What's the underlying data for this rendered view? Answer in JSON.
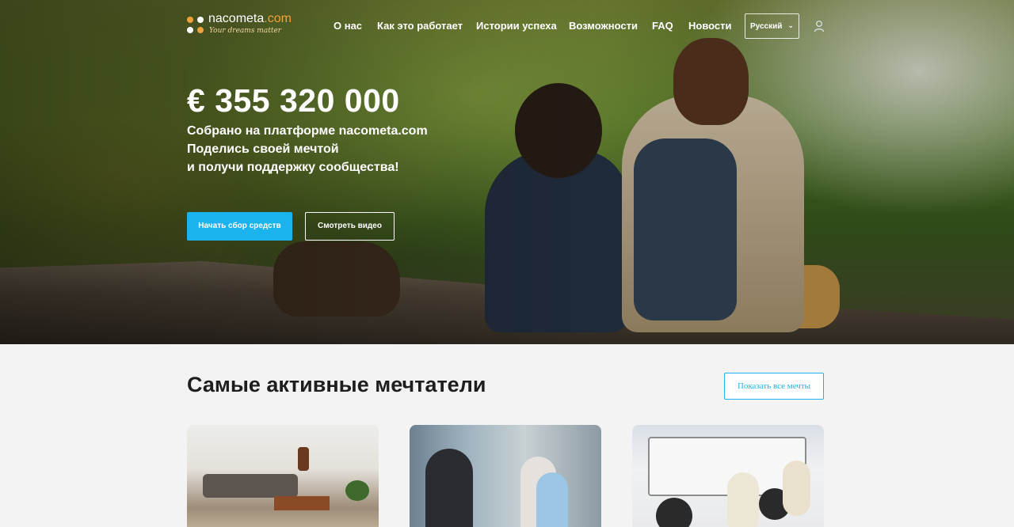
{
  "brand": {
    "name": "nacometa",
    "domain": ".com",
    "tagline": "Your dreams matter"
  },
  "nav": {
    "items": [
      {
        "label": "О нас"
      },
      {
        "label": "Как это работает"
      },
      {
        "label": "Истории успеха"
      },
      {
        "label": "Возможности"
      },
      {
        "label": "FAQ"
      },
      {
        "label": "Новости"
      }
    ],
    "language": "Русский"
  },
  "hero": {
    "amount": "€ 355 320 000",
    "line1": "Собрано на платформе nacometa.com",
    "line2": "Поделись своей мечтой",
    "line3": "и получи поддержку сообщества!",
    "primary_button": "Начать сбор средств",
    "secondary_button": "Смотреть видео"
  },
  "section": {
    "title": "Самые активные мечтатели",
    "show_all": "Показать все мечты"
  },
  "colors": {
    "accent": "#1bb3ee",
    "logo_orange": "#f0a23a"
  }
}
